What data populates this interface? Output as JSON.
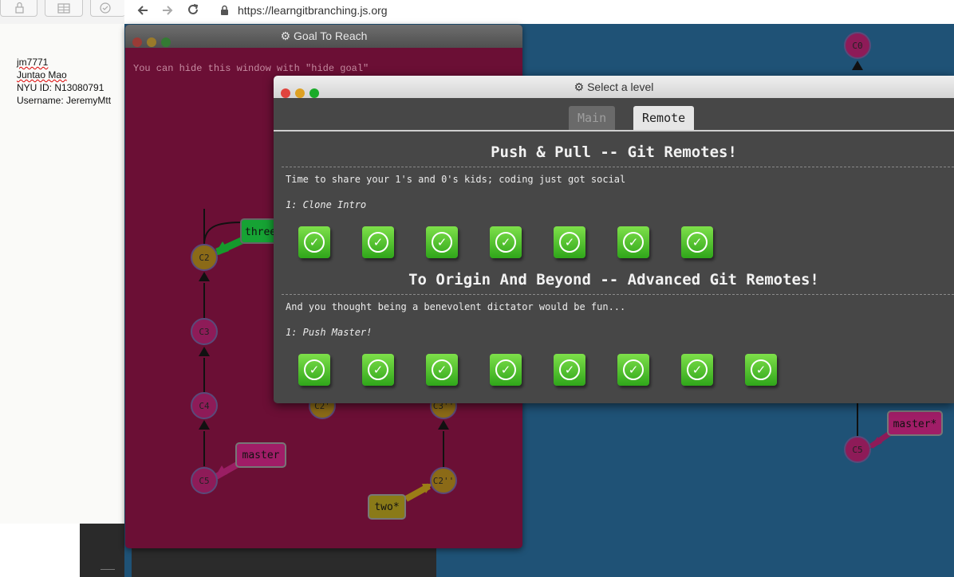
{
  "browser": {
    "url": "https://learngitbranching.js.org"
  },
  "doc": {
    "lines": [
      "jm7771",
      "Juntao Mao",
      "NYU ID: N13080791",
      "Username: JeremyMtt"
    ]
  },
  "goal_window": {
    "title": "Goal To Reach",
    "hint": "You can hide this window with \"hide goal\"",
    "nodes": [
      "C2",
      "C3",
      "C4",
      "C5",
      "C2'",
      "C3''",
      "C2''"
    ],
    "branches": [
      "three",
      "master",
      "two*"
    ]
  },
  "right_graph": {
    "nodes": [
      "C0",
      "C5"
    ],
    "branches": [
      "master*"
    ]
  },
  "dialog": {
    "title": "Select a level",
    "tabs": [
      "Main",
      "Remote"
    ],
    "active_tab": "Remote",
    "sections": [
      {
        "title": "Push & Pull -- Git Remotes!",
        "desc": "Time to share your 1's and 0's kids; coding just got social",
        "level": "1: Clone Intro",
        "completed_count": 7
      },
      {
        "title": "To Origin And Beyond -- Advanced Git Remotes!",
        "desc": "And you thought being a benevolent dictator would be fun...",
        "level": "1: Push Master!",
        "completed_count": 8
      }
    ]
  },
  "colors": {
    "canvas_bg": "#1f5276",
    "goal_bg": "#6b0f35",
    "dialog_bg": "#474747",
    "level_green": "#3fb821"
  },
  "icons": [
    "back-arrow-icon",
    "forward-arrow-icon",
    "reload-icon",
    "lock-icon",
    "gear-icon",
    "checkmark-icon"
  ]
}
